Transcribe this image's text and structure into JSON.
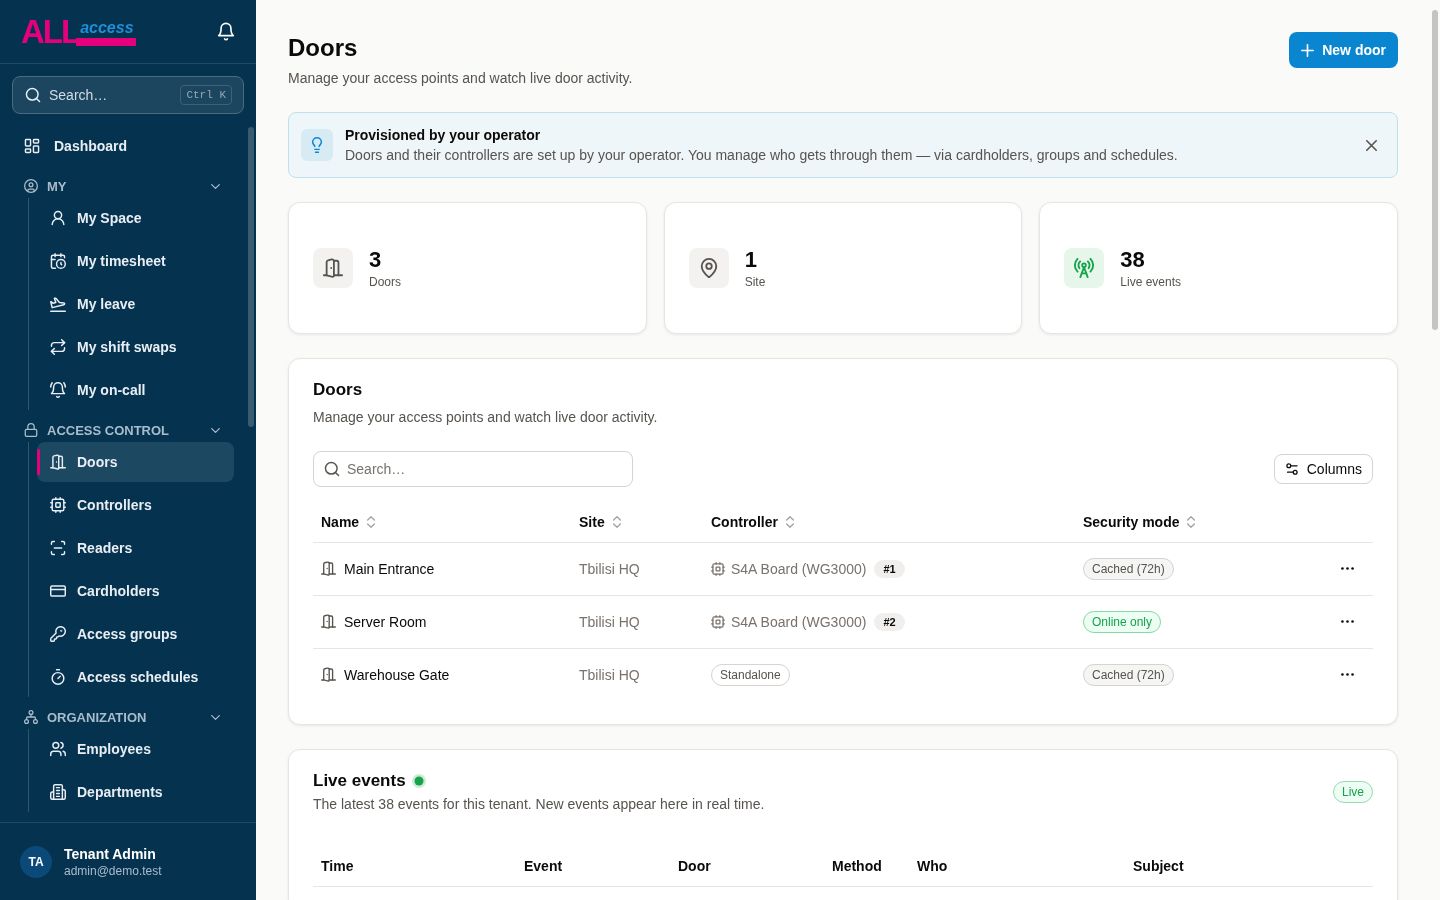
{
  "sidebar": {
    "logo": {
      "primary": "ALL",
      "secondary": "access"
    },
    "search": {
      "placeholder": "Search…",
      "shortcut": "Ctrl K"
    },
    "nav": [
      {
        "kind": "link",
        "label": "Dashboard",
        "selected": false
      },
      {
        "kind": "section",
        "label": "MY",
        "expanded": true,
        "children": [
          {
            "label": "My Space",
            "selected": false
          },
          {
            "label": "My timesheet",
            "selected": false
          },
          {
            "label": "My leave",
            "selected": false
          },
          {
            "label": "My shift swaps",
            "selected": false
          },
          {
            "label": "My on-call",
            "selected": false
          }
        ]
      },
      {
        "kind": "section",
        "label": "ACCESS CONTROL",
        "expanded": true,
        "children": [
          {
            "label": "Doors",
            "selected": true
          },
          {
            "label": "Controllers",
            "selected": false
          },
          {
            "label": "Readers",
            "selected": false
          },
          {
            "label": "Cardholders",
            "selected": false
          },
          {
            "label": "Access groups",
            "selected": false
          },
          {
            "label": "Access schedules",
            "selected": false
          }
        ]
      },
      {
        "kind": "section",
        "label": "ORGANIZATION",
        "expanded": true,
        "children": [
          {
            "label": "Employees",
            "selected": false
          },
          {
            "label": "Departments",
            "selected": false
          }
        ]
      }
    ],
    "user": {
      "initials": "TA",
      "name": "Tenant Admin",
      "email": "admin@demo.test"
    }
  },
  "header": {
    "title": "Doors",
    "subtitle": "Manage your access points and watch live door activity.",
    "action": "New door"
  },
  "banner": {
    "title": "Provisioned by your operator",
    "text": "Doors and their controllers are set up by your operator. You manage who gets through them — via cardholders, groups and schedules.",
    "dismissible": true
  },
  "stats": [
    {
      "kind": "doors",
      "value": "3",
      "label": "Doors"
    },
    {
      "kind": "sites",
      "value": "1",
      "label": "Site"
    },
    {
      "kind": "live",
      "value": "38",
      "label": "Live events"
    }
  ],
  "doors": {
    "title": "Doors",
    "subtitle": "Manage your access points and watch live door activity.",
    "search": {
      "placeholder": "Search…"
    },
    "columns_button": "Columns",
    "table": {
      "columns": [
        {
          "label": "Name",
          "sortable": true
        },
        {
          "label": "Site",
          "sortable": true
        },
        {
          "label": "Controller",
          "sortable": true
        },
        {
          "label": "Security mode",
          "sortable": true
        }
      ],
      "rows": [
        {
          "name": "Main Entrance",
          "site": "Tbilisi HQ",
          "controller": {
            "kind": "board",
            "name": "S4A Board (WG3000)",
            "port": "#1"
          },
          "security_mode": {
            "kind": "cached",
            "label": "Cached (72h)"
          }
        },
        {
          "name": "Server Room",
          "site": "Tbilisi HQ",
          "controller": {
            "kind": "board",
            "name": "S4A Board (WG3000)",
            "port": "#2"
          },
          "security_mode": {
            "kind": "online",
            "label": "Online only"
          }
        },
        {
          "name": "Warehouse Gate",
          "site": "Tbilisi HQ",
          "controller": {
            "kind": "standalone",
            "label": "Standalone"
          },
          "security_mode": {
            "kind": "cached",
            "label": "Cached (72h)"
          }
        }
      ]
    }
  },
  "live_events": {
    "title": "Live events",
    "live": true,
    "subtitle": "The latest 38 events for this tenant. New events appear here in real time.",
    "badge": "Live",
    "table": {
      "columns": [
        "Time",
        "Event",
        "Door",
        "Method",
        "Who",
        "Subject"
      ]
    }
  }
}
